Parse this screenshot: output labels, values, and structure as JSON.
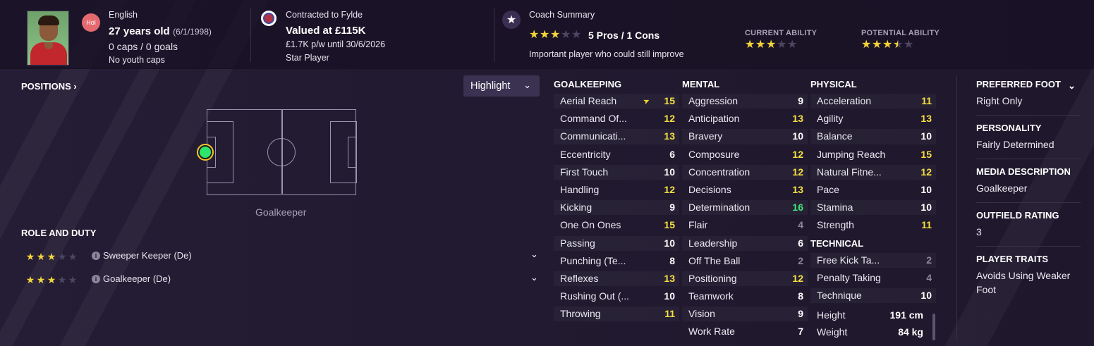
{
  "header": {
    "nationality": "English",
    "nat_badge": "Hol",
    "age": "27 years old",
    "dob": "(6/1/1998)",
    "caps": "0 caps / 0 goals",
    "youth_caps": "No youth caps",
    "contract": "Contracted to Fylde",
    "value": "Valued at £115K",
    "wage": "£1.7K p/w until 30/6/2026",
    "status": "Star Player",
    "coach_summary_label": "Coach Summary",
    "pros_cons": "5 Pros / 1 Cons",
    "summary_text": "Important player who could still improve",
    "summary_stars": 3,
    "current_ability_label": "CURRENT ABILITY",
    "current_ability_stars": 3,
    "potential_ability_label": "POTENTIAL ABILITY",
    "potential_ability_stars": 3.5
  },
  "positions": {
    "title": "POSITIONS",
    "highlight_label": "Highlight",
    "position_label": "Goalkeeper"
  },
  "roles": {
    "title": "ROLE AND DUTY",
    "items": [
      {
        "name": "Sweeper Keeper (De)",
        "stars": 3
      },
      {
        "name": "Goalkeeper (De)",
        "stars": 3
      }
    ]
  },
  "attributes": {
    "goalkeeping": {
      "title": "GOALKEEPING",
      "items": [
        {
          "name": "Aerial Reach",
          "value": "15",
          "color": "yellow",
          "arrow": true
        },
        {
          "name": "Command Of...",
          "value": "12",
          "color": "yellow"
        },
        {
          "name": "Communicati...",
          "value": "13",
          "color": "yellow"
        },
        {
          "name": "Eccentricity",
          "value": "6",
          "color": "white"
        },
        {
          "name": "First Touch",
          "value": "10",
          "color": "white"
        },
        {
          "name": "Handling",
          "value": "12",
          "color": "yellow"
        },
        {
          "name": "Kicking",
          "value": "9",
          "color": "white"
        },
        {
          "name": "One On Ones",
          "value": "15",
          "color": "yellow"
        },
        {
          "name": "Passing",
          "value": "10",
          "color": "white"
        },
        {
          "name": "Punching (Te...",
          "value": "8",
          "color": "white"
        },
        {
          "name": "Reflexes",
          "value": "13",
          "color": "yellow"
        },
        {
          "name": "Rushing Out (...",
          "value": "10",
          "color": "white"
        },
        {
          "name": "Throwing",
          "value": "11",
          "color": "yellow"
        }
      ]
    },
    "mental": {
      "title": "MENTAL",
      "items": [
        {
          "name": "Aggression",
          "value": "9",
          "color": "white"
        },
        {
          "name": "Anticipation",
          "value": "13",
          "color": "yellow"
        },
        {
          "name": "Bravery",
          "value": "10",
          "color": "white"
        },
        {
          "name": "Composure",
          "value": "12",
          "color": "yellow"
        },
        {
          "name": "Concentration",
          "value": "12",
          "color": "yellow"
        },
        {
          "name": "Decisions",
          "value": "13",
          "color": "yellow"
        },
        {
          "name": "Determination",
          "value": "16",
          "color": "green"
        },
        {
          "name": "Flair",
          "value": "4",
          "color": "grey"
        },
        {
          "name": "Leadership",
          "value": "6",
          "color": "white"
        },
        {
          "name": "Off The Ball",
          "value": "2",
          "color": "grey"
        },
        {
          "name": "Positioning",
          "value": "12",
          "color": "yellow"
        },
        {
          "name": "Teamwork",
          "value": "8",
          "color": "white"
        },
        {
          "name": "Vision",
          "value": "9",
          "color": "white"
        },
        {
          "name": "Work Rate",
          "value": "7",
          "color": "white"
        }
      ]
    },
    "physical": {
      "title": "PHYSICAL",
      "items": [
        {
          "name": "Acceleration",
          "value": "11",
          "color": "yellow"
        },
        {
          "name": "Agility",
          "value": "13",
          "color": "yellow"
        },
        {
          "name": "Balance",
          "value": "10",
          "color": "white"
        },
        {
          "name": "Jumping Reach",
          "value": "15",
          "color": "yellow"
        },
        {
          "name": "Natural Fitne...",
          "value": "12",
          "color": "yellow"
        },
        {
          "name": "Pace",
          "value": "10",
          "color": "white"
        },
        {
          "name": "Stamina",
          "value": "10",
          "color": "white"
        },
        {
          "name": "Strength",
          "value": "11",
          "color": "yellow"
        }
      ]
    },
    "technical": {
      "title": "TECHNICAL",
      "items": [
        {
          "name": "Free Kick Ta...",
          "value": "2",
          "color": "grey"
        },
        {
          "name": "Penalty Taking",
          "value": "4",
          "color": "grey"
        },
        {
          "name": "Technique",
          "value": "10",
          "color": "white"
        }
      ]
    },
    "height_label": "Height",
    "height_value": "191 cm",
    "weight_label": "Weight",
    "weight_value": "84 kg"
  },
  "info_panel": {
    "items": [
      {
        "title": "PREFERRED FOOT",
        "value": "Right Only"
      },
      {
        "title": "PERSONALITY",
        "value": "Fairly Determined"
      },
      {
        "title": "MEDIA DESCRIPTION",
        "value": "Goalkeeper"
      },
      {
        "title": "OUTFIELD RATING",
        "value": "3"
      },
      {
        "title": "PLAYER TRAITS",
        "value": "Avoids Using Weaker Foot"
      }
    ]
  },
  "colors": {
    "yellow": "#f3e040",
    "green": "#3ee77a",
    "grey": "#8f889c",
    "white": "#ffffff",
    "star": "#f3d53a"
  },
  "icons": [
    "player-photo",
    "nation-badge",
    "club-crest-icon",
    "star-icon",
    "chevron-down-icon",
    "chevron-right-icon",
    "info-icon",
    "arrow-icon"
  ]
}
